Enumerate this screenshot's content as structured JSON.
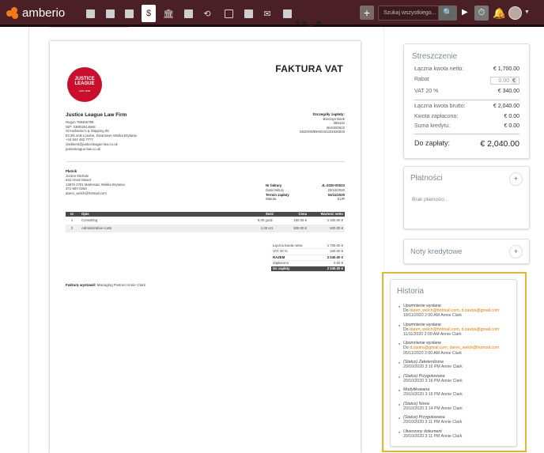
{
  "topbar": {
    "brand": "amberio",
    "search_placeholder": "Szukaj wszystkiego...",
    "notification_count": "2"
  },
  "invoice": {
    "seal": {
      "line1": "JUSTICE",
      "line2": "LEAGUE",
      "line3": "LAW FIRM"
    },
    "title": "FAKTURA VAT",
    "seller": {
      "name": "Justice League Law Firm",
      "lines": [
        "Regon 789456789",
        "NIP: GB00251456S",
        "St Katharine's & Wapping 95",
        "EC3N 4AB London, Downtown Wielka Brytania",
        "+44 844 482 7777",
        "clarkkent@justiceleague-law.co.uk",
        "justiceleague-law.co.uk"
      ]
    },
    "payment": {
      "heading": "Szczegóły zapłaty:",
      "lines": [
        "Barclays Bank",
        "385442",
        "BUKBGB22",
        "GB29NWBK60161331926819"
      ]
    },
    "buyer": {
      "heading": "Płatnik",
      "lines": [
        "Jordon Michale",
        "642 Anais Mount",
        "13876 2701 Markssad, Wielka Brytania",
        "371-697-0250",
        "daren_welch@hotmail.com"
      ]
    },
    "meta": [
      {
        "label": "Nr faktury",
        "value": "JL-2020-00023",
        "bold": true
      },
      {
        "label": "Data faktury",
        "value": "20/10/2020",
        "bold": false
      },
      {
        "label": "Termin zapłaty",
        "value": "04/11/2020",
        "bold": true
      },
      {
        "label": "Waluta",
        "value": "EUR",
        "bold": false
      }
    ],
    "table": {
      "headers": [
        "nr",
        "Opis",
        "Ilość",
        "Cena",
        "Wartość netto"
      ],
      "rows": [
        [
          "1",
          "Consulting",
          "8,00 godz.",
          "150.00 €",
          "1 200.00 €"
        ],
        [
          "2",
          "Administrative costs",
          "1,00 szt.",
          "500.00 €",
          "500.00 €"
        ]
      ]
    },
    "summary": [
      {
        "label": "Łączna kwota netto:",
        "value": "1 700.00 €",
        "style": ""
      },
      {
        "label": "VAT 20 %",
        "value": "340.00 €",
        "style": ""
      },
      {
        "label": "RAZEM",
        "value": "2 040.00 €",
        "style": "b"
      },
      {
        "label": "Zapłacono",
        "value": "0.00 €",
        "style": ""
      },
      {
        "label": "Do zapłaty",
        "value": "2 040.00 €",
        "style": "due"
      }
    ],
    "issued_label": "Fakturę wystawił:",
    "issued_by": "Managing Partner Annie Clark"
  },
  "sidebar": {
    "summary": {
      "title": "Streszczenie",
      "net_label": "Łączna kwota netto:",
      "net_value": "€ 1,700.00",
      "rabat_label": "Rabat",
      "rabat_value": "0.00",
      "rabat_unit": "€",
      "vat_label": "VAT 20 %",
      "vat_value": "€ 340.00",
      "gross_label": "Łączna kwota brutto:",
      "gross_value": "€ 2,040.00",
      "paid_label": "Kwota zapłacona:",
      "paid_value": "€ 0.00",
      "credit_label": "Suma kredytu:",
      "credit_value": "€ 0.00",
      "due_label": "Do zapłaty:",
      "due_value": "€ 2,040.00"
    },
    "payments": {
      "title": "Płatności",
      "empty": "Brak płatności..."
    },
    "credit_notes": {
      "title": "Noty kredytowe"
    },
    "history": {
      "title": "Historia",
      "events": [
        {
          "title": "Upomnienie wysłane",
          "to_prefix": "Do ",
          "to": "daren_welch@hotmail.com, d.zautra@gmail.com",
          "meta": "18/11/2020 2:00 AM Annie Clark"
        },
        {
          "title": "Upomnienie wysłane",
          "to_prefix": "Do ",
          "to": "daren_welch@hotmail.com, d.zautra@gmail.com",
          "meta": "11/11/2020 2:00 AM Annie Clark"
        },
        {
          "title": "Upomnienie wysłane",
          "to_prefix": "Do ",
          "to": "d.zautra@gmail.com, daren_welch@hotmail.com",
          "meta": "05/11/2020 2:00 AM Annie Clark"
        },
        {
          "title": "(Status) Zatwierdzona",
          "meta": "20/10/2020 3:16 PM Annie Clark"
        },
        {
          "title": "(Status) Przygotowana",
          "meta": "20/10/2020 3:16 PM Annie Clark"
        },
        {
          "title": "Modyfikowana",
          "meta": "20/10/2020 3:16 PM Annie Clark"
        },
        {
          "title": "(Status) Nowa",
          "meta": "20/10/2020 3:14 PM Annie Clark"
        },
        {
          "title": "(Status) Przygotowana",
          "meta": "20/10/2020 3:11 PM Annie Clark"
        },
        {
          "title": "Utworzony dokument",
          "meta": "20/10/2020 3:11 PM Annie Clark"
        }
      ]
    }
  }
}
